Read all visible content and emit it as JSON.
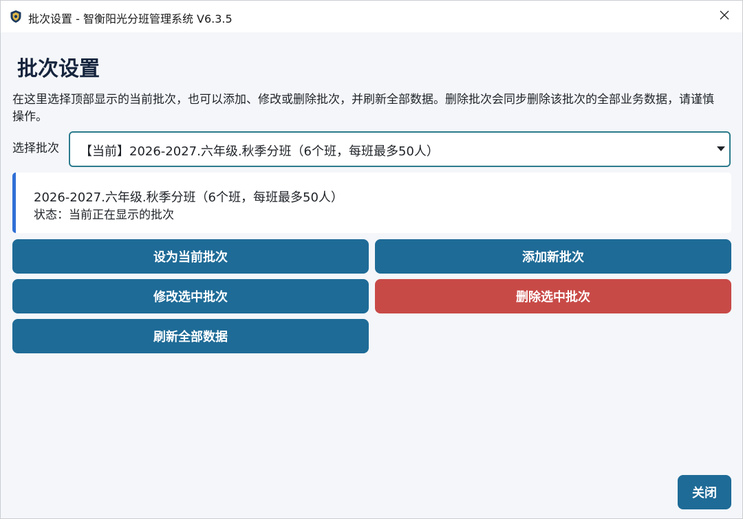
{
  "window": {
    "title": "批次设置 - 智衡阳光分班管理系统 V6.3.5",
    "icon": "shield-icon",
    "close_icon": "close-icon"
  },
  "page": {
    "heading": "批次设置",
    "description": "在这里选择顶部显示的当前批次，也可以添加、修改或删除批次，并刷新全部数据。删除批次会同步删除该批次的全部业务数据，请谨慎操作。"
  },
  "batch_select": {
    "label": "选择批次",
    "selected_value": "【当前】2026-2027.六年级.秋季分班（6个班，每班最多50人）"
  },
  "info_card": {
    "batch_name": "2026-2027.六年级.秋季分班（6个班，每班最多50人）",
    "status": "状态：当前正在显示的批次"
  },
  "actions": {
    "set_current": "设为当前批次",
    "add_new": "添加新批次",
    "edit_selected": "修改选中批次",
    "delete_selected": "删除选中批次",
    "refresh_all": "刷新全部数据"
  },
  "footer": {
    "close": "关闭"
  },
  "colors": {
    "primary_button": "#1e6b97",
    "danger_button": "#c84a47",
    "accent_border": "#2f6fd6",
    "select_border": "#2b7a8c",
    "heading": "#15243d"
  }
}
